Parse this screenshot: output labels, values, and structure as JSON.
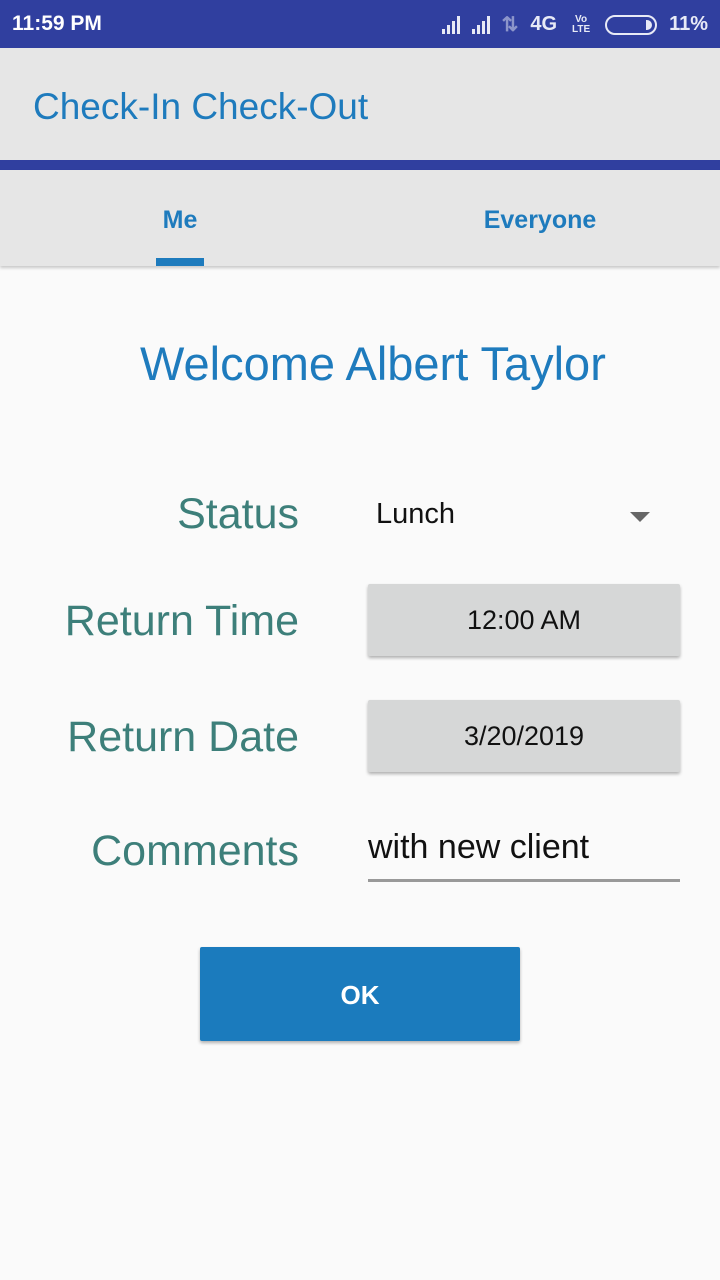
{
  "status_bar": {
    "time": "11:59 PM",
    "network": "4G",
    "volte": "Vo LTE",
    "battery": "11%"
  },
  "app_bar": {
    "title": "Check-In Check-Out"
  },
  "tabs": [
    {
      "label": "Me",
      "selected": true
    },
    {
      "label": "Everyone",
      "selected": false
    }
  ],
  "form": {
    "welcome": "Welcome Albert Taylor",
    "status_label": "Status",
    "status_value": "Lunch",
    "return_time_label": "Return Time",
    "return_time_value": "12:00 AM",
    "return_date_label": "Return Date",
    "return_date_value": "3/20/2019",
    "comments_label": "Comments",
    "comments_value": "with new client",
    "ok_label": "OK"
  },
  "colors": {
    "primary_dark": "#303f9f",
    "accent": "#1e7bbd",
    "label": "#3d7f7a"
  }
}
